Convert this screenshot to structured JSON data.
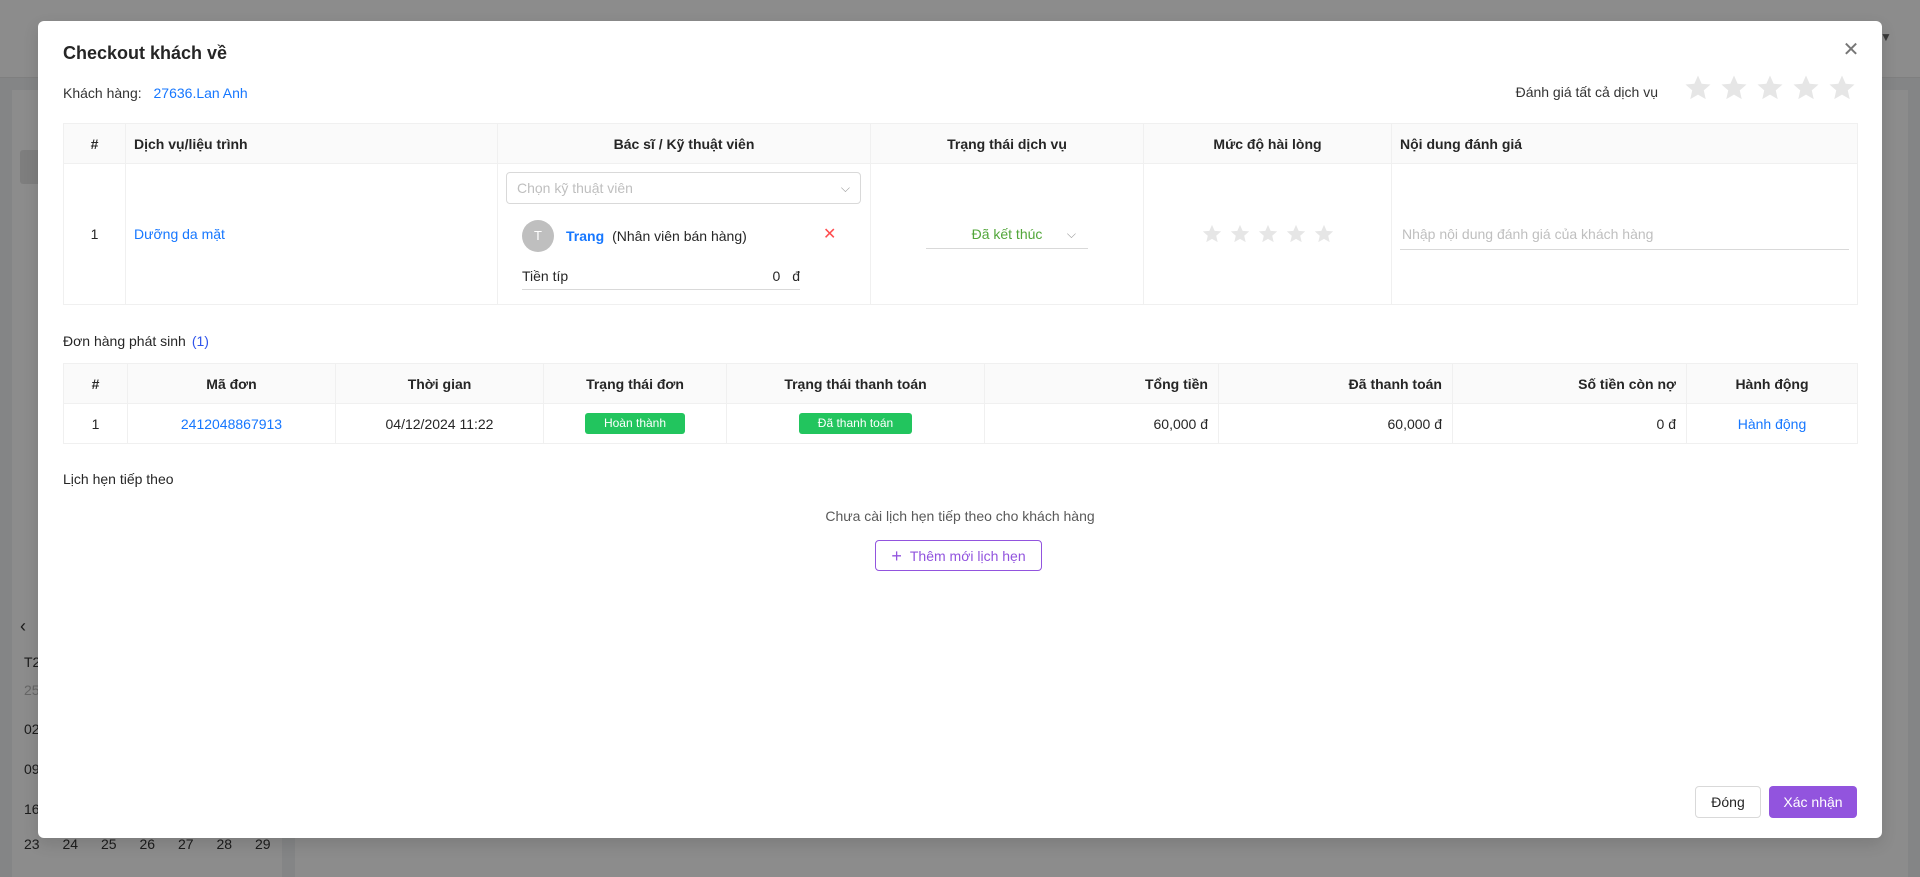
{
  "background": {
    "calendar_rows": [
      "T2",
      "25",
      "02",
      "09",
      "16"
    ],
    "calendar_last_week": [
      "23",
      "24",
      "25",
      "26",
      "27",
      "28",
      "29"
    ]
  },
  "modal": {
    "title": "Checkout khách về",
    "customer_label": "Khách hàng:",
    "customer_name": "27636.Lan Anh",
    "rate_all_label": "Đánh giá tất cả dịch vụ",
    "rate_all_stars": 0
  },
  "services": {
    "headers": [
      "#",
      "Dịch vụ/liệu trình",
      "Bác sĩ / Kỹ thuật viên",
      "Trạng thái dịch vụ",
      "Mức độ hài lòng",
      "Nội dung đánh giá"
    ],
    "rows": [
      {
        "index": "1",
        "service": "Dưỡng da mặt",
        "tech_select_placeholder": "Chọn kỹ thuật viên",
        "tech_avatar": "T",
        "tech_name": "Trang",
        "tech_role": "(Nhân viên bán hàng)",
        "tip_label": "Tiền típ",
        "tip_value": "0",
        "tip_currency": "đ",
        "status": "Đã kết thúc",
        "satisfaction_stars": 0,
        "review_placeholder": "Nhập nội dung đánh giá của khách hàng"
      }
    ]
  },
  "orders": {
    "section_label": "Đơn hàng phát sinh",
    "count": "(1)",
    "headers": [
      "#",
      "Mã đơn",
      "Thời gian",
      "Trạng thái đơn",
      "Trạng thái thanh toán",
      "Tổng tiền",
      "Đã thanh toán",
      "Số tiền còn nợ",
      "Hành động"
    ],
    "rows": [
      {
        "index": "1",
        "code": "2412048867913",
        "time": "04/12/2024 11:22",
        "order_status": "Hoàn thành",
        "payment_status": "Đã thanh toán",
        "total": "60,000 đ",
        "paid": "60,000 đ",
        "debt": "0 đ",
        "action": "Hành động"
      }
    ]
  },
  "appointments": {
    "section_label": "Lịch hẹn tiếp theo",
    "empty_text": "Chưa cài lịch hẹn tiếp theo cho khách hàng",
    "add_button": "Thêm mới lịch hẹn"
  },
  "footer": {
    "close_button": "Đóng",
    "confirm_button": "Xác nhận"
  },
  "colors": {
    "primary_purple": "#9254de",
    "link_blue": "#1677ff",
    "success_green": "#22c55e",
    "danger_red": "#ff4d4f"
  }
}
